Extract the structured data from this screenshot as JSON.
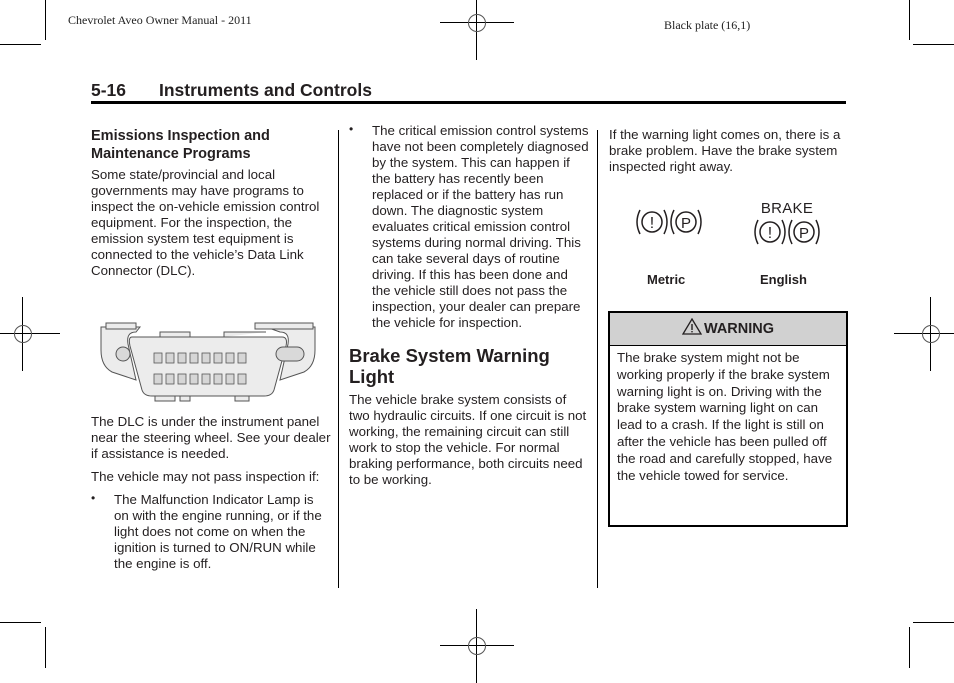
{
  "page_header": {
    "manual_title": "Chevrolet Aveo Owner Manual - 2011",
    "plate_label": "Black plate (16,1)"
  },
  "section": {
    "page_number": "5-16",
    "title": "Instruments and Controls"
  },
  "column1": {
    "heading": "Emissions Inspection and Maintenance Programs",
    "intro": "Some state/provincial and local governments may have programs to inspect the on-vehicle emission control equipment. For the inspection, the emission system test equipment is connected to the vehicle’s Data Link Connector (DLC).",
    "figure_label": "Data Link Connector illustration",
    "dlc_location": "The DLC is under the instrument panel near the steering wheel. See your dealer if assistance is needed.",
    "may_not_pass": "The vehicle may not pass inspection if:",
    "bullets": [
      "The Malfunction Indicator Lamp is on with the engine running, or if the light does not come on when the ignition is turned to ON/RUN while the engine is off."
    ]
  },
  "column2": {
    "bullets": [
      "The critical emission control systems have not been completely diagnosed by the system. This can happen if the battery has recently been replaced or if the battery has run down. The diagnostic system evaluates critical emission control systems during normal driving. This can take several days of routine driving. If this has been done and the vehicle still does not pass the inspection, your dealer can prepare the vehicle for inspection."
    ],
    "heading": "Brake System Warning Light",
    "body": "The vehicle brake system consists of two hydraulic circuits. If one circuit is not working, the remaining circuit can still work to stop the vehicle. For normal braking performance, both circuits need to be working."
  },
  "column3": {
    "intro": "If the warning light comes on, there is a brake problem. Have the brake system inspected right away.",
    "symbols": {
      "metric_caption": "Metric",
      "english_caption": "English",
      "english_word": "BRAKE",
      "exclamation_glyph": "!",
      "park_glyph": "P"
    },
    "warning": {
      "title": "WARNING",
      "body": "The brake system might not be working properly if the brake system warning light is on. Driving with the brake system warning light on can lead to a crash. If the light is still on after the vehicle has been pulled off the road and carefully stopped, have the vehicle towed for service."
    }
  },
  "bullet_glyph": "•"
}
